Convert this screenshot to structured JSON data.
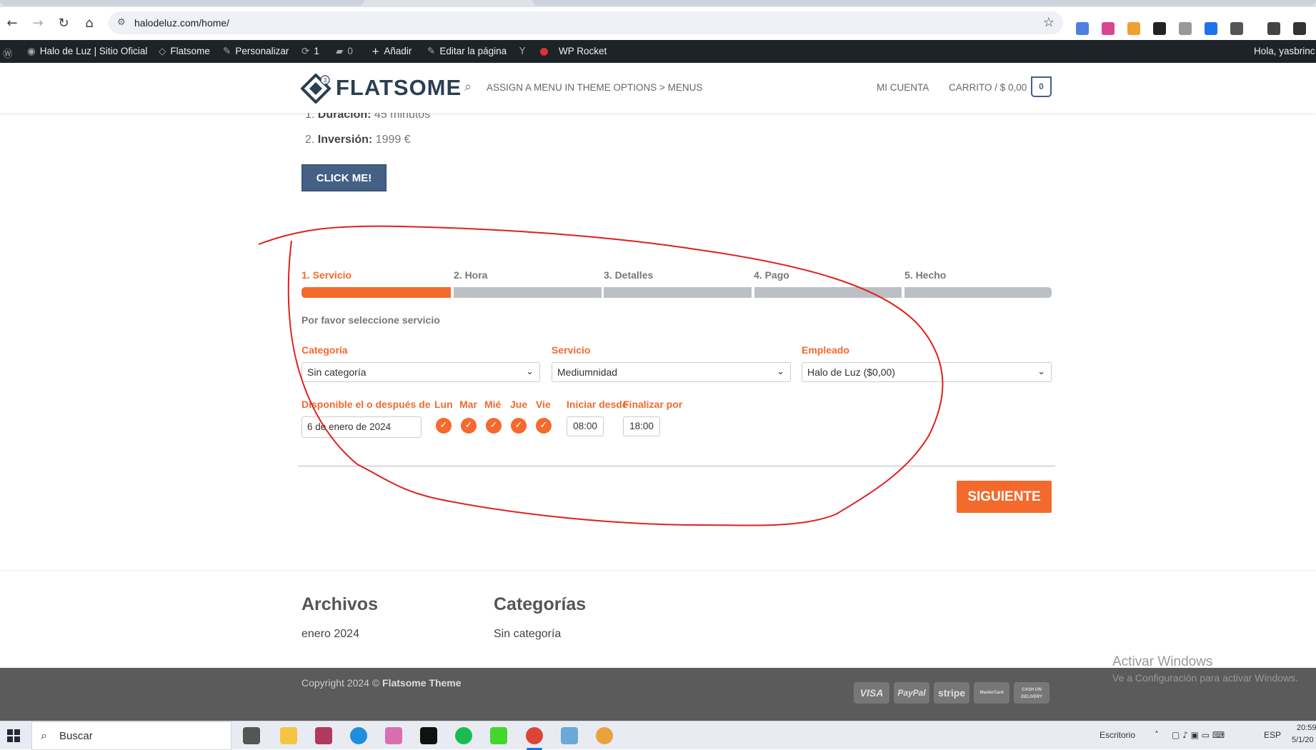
{
  "browser": {
    "url": "halodeluz.com/home/"
  },
  "admin_bar": {
    "site_name": "Halo de Luz | Sitio Oficial",
    "theme": "Flatsome",
    "customize": "Personalizar",
    "updates_count": "1",
    "comments_count": "0",
    "add_new": "Añadir",
    "edit_page": "Editar la página",
    "wp_rocket": "WP Rocket",
    "greeting": "Hola, yasbrinc"
  },
  "header": {
    "logo_text": "FLATSOME",
    "logo_badge": "3",
    "menu_hint": "ASSIGN A MENU IN THEME OPTIONS > MENUS",
    "my_account": "MI CUENTA",
    "cart_label": "CARRITO / $ 0,00",
    "cart_count": "0"
  },
  "content": {
    "list": [
      {
        "num": "1.",
        "label": "Duración:",
        "value": "45 minutos"
      },
      {
        "num": "2.",
        "label": "Inversión:",
        "value": "1999 €"
      }
    ],
    "cta_label": "CLICK ME!"
  },
  "booking": {
    "steps": [
      "1. Servicio",
      "2. Hora",
      "3. Detalles",
      "4. Pago",
      "5. Hecho"
    ],
    "active_step": 1,
    "instructions": "Por favor seleccione servicio",
    "category_label": "Categoría",
    "category_value": "Sin categoría",
    "service_label": "Servicio",
    "service_value": "Mediumnidad",
    "employee_label": "Empleado",
    "employee_value": "Halo de Luz ($0,00)",
    "available_label": "Disponible el o después de",
    "date_value": "6 de enero de 2024",
    "days": [
      {
        "label": "Lun",
        "checked": true
      },
      {
        "label": "Mar",
        "checked": true
      },
      {
        "label": "Mié",
        "checked": true
      },
      {
        "label": "Jue",
        "checked": true
      },
      {
        "label": "Vie",
        "checked": true
      }
    ],
    "start_label": "Iniciar desde",
    "end_label": "Finalizar por",
    "start_value": "08:00",
    "end_value": "18:00",
    "next_label": "SIGUIENTE",
    "accent_color": "#f4692c"
  },
  "footer": {
    "archives_title": "Archivos",
    "archives_link": "enero 2024",
    "categories_title": "Categorías",
    "categories_link": "Sin categoría",
    "copyright_prefix": "Copyright 2024 ©",
    "copyright_brand": "Flatsome Theme",
    "payments": [
      "VISA",
      "PayPal",
      "stripe",
      "MasterCard",
      "CASH ON DELIVERY"
    ]
  },
  "windows": {
    "activate_title": "Activar Windows",
    "activate_sub": "Ve a Configuración para activar Windows.",
    "search_placeholder": "Buscar",
    "desktop_label": "Escritorio",
    "language": "ESP",
    "time": "20:59",
    "date": "5/1/20"
  }
}
